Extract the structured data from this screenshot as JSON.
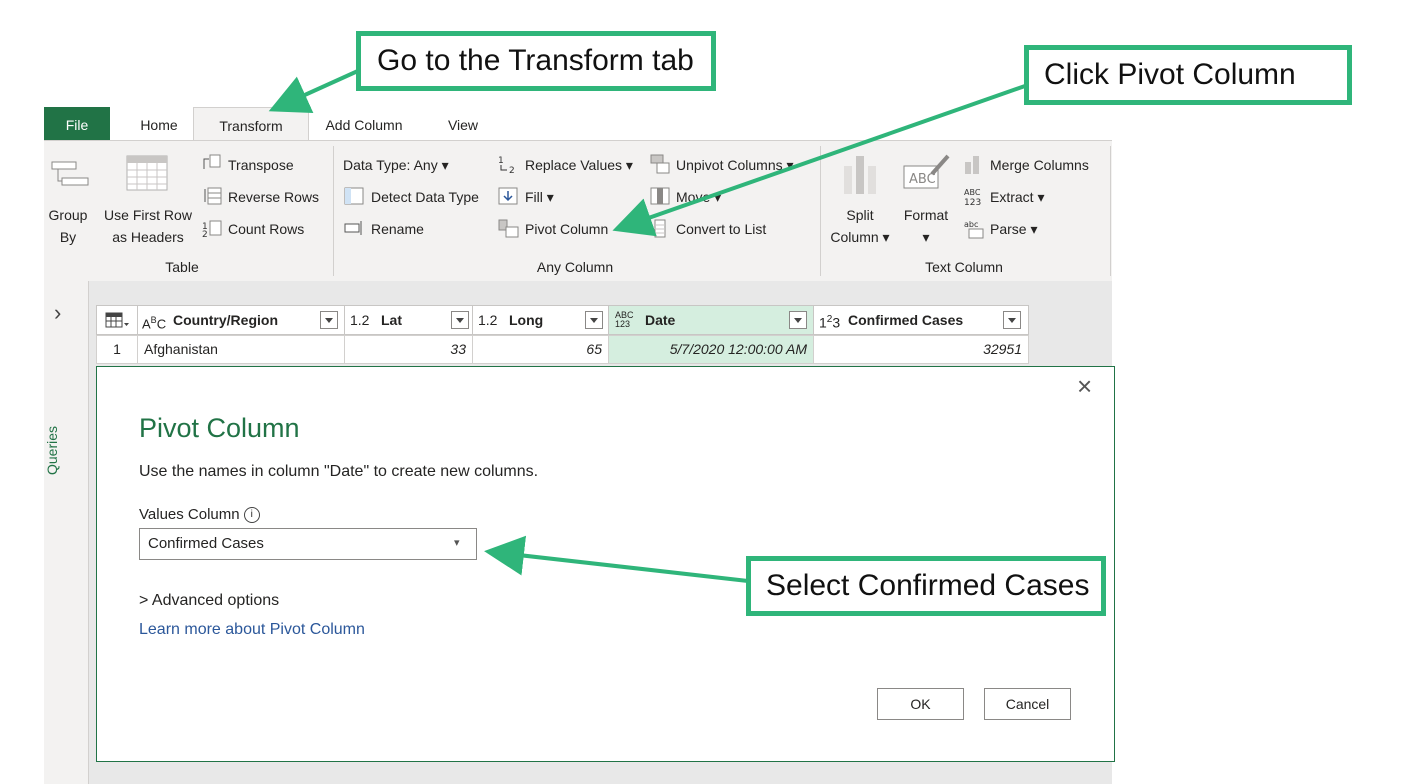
{
  "ribbon": {
    "tabs": [
      "File",
      "Home",
      "Transform",
      "Add Column",
      "View"
    ],
    "table_group": {
      "group_by": [
        "Group",
        "By"
      ],
      "use_first_row": [
        "Use First Row",
        "as Headers"
      ],
      "transpose": "Transpose",
      "reverse_rows": "Reverse Rows",
      "count_rows": "Count Rows",
      "label": "Table"
    },
    "any_column_group": {
      "data_type": "Data Type: Any",
      "detect_data_type": "Detect Data Type",
      "rename": "Rename",
      "replace_values": "Replace Values",
      "fill": "Fill",
      "pivot_column": "Pivot Column",
      "unpivot_columns": "Unpivot Columns",
      "move": "Move",
      "convert_to_list": "Convert to List",
      "label": "Any Column"
    },
    "text_column_group": {
      "split_column": [
        "Split",
        "Column"
      ],
      "format": "Format",
      "merge_columns": "Merge Columns",
      "extract": "Extract",
      "parse": "Parse",
      "label": "Text Column"
    }
  },
  "left_pane": {
    "toggle": "›",
    "queries_label": "Queries"
  },
  "grid": {
    "columns": [
      {
        "type": "ABC",
        "name": "Country/Region"
      },
      {
        "type": "1.2",
        "name": "Lat"
      },
      {
        "type": "1.2",
        "name": "Long"
      },
      {
        "type": "ABC/123",
        "name": "Date"
      },
      {
        "type": "123",
        "name": "Confirmed Cases"
      }
    ],
    "rows": [
      {
        "index": "1",
        "cells": [
          "Afghanistan",
          "33",
          "65",
          "5/7/2020 12:00:00 AM",
          "32951"
        ]
      }
    ]
  },
  "dialog": {
    "title": "Pivot Column",
    "description": "Use the names in column \"Date\" to create new columns.",
    "values_label": "Values Column",
    "values_selected": "Confirmed Cases",
    "advanced_options": "Advanced options",
    "learn_more": "Learn more about Pivot Column",
    "ok": "OK",
    "cancel": "Cancel",
    "close": "×"
  },
  "callouts": {
    "transform_tab": "Go to the Transform tab",
    "pivot_column": "Click Pivot Column",
    "confirmed_cases": "Select Confirmed Cases"
  },
  "colors": {
    "accent_green": "#217346",
    "callout_green": "#2fb57a",
    "link_blue": "#2b579a",
    "date_highlight": "#d5eedf"
  }
}
